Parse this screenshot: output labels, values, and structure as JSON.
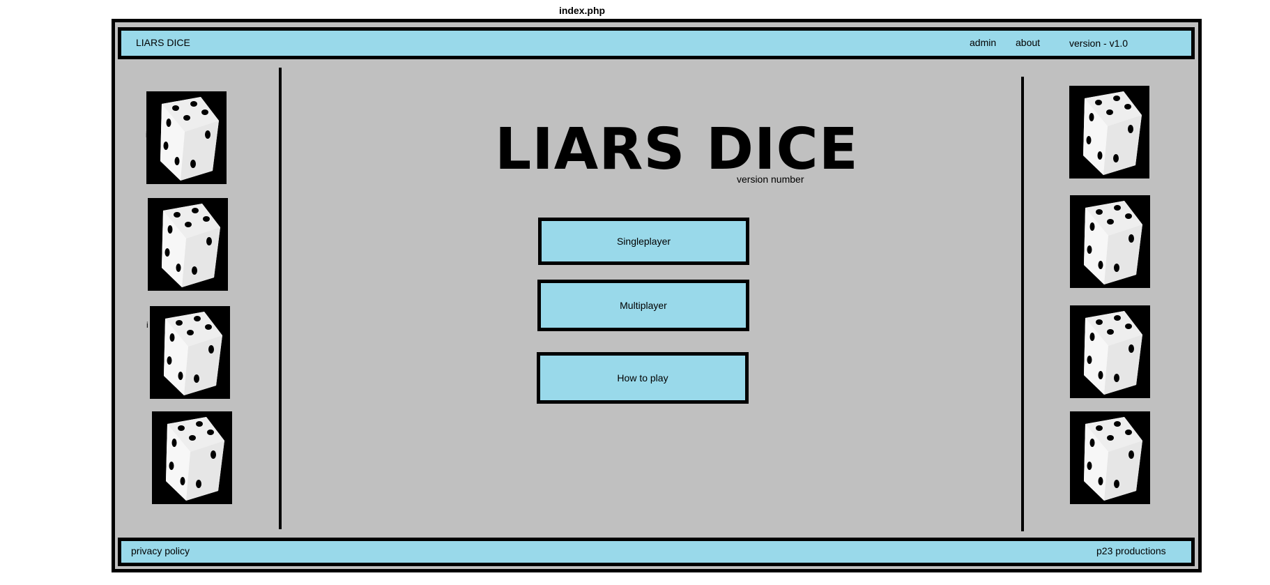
{
  "page": {
    "filename": "index.php"
  },
  "header": {
    "title": "LIARS DICE",
    "nav": [
      {
        "label": "admin"
      },
      {
        "label": "about"
      }
    ],
    "version": "version - v1.0"
  },
  "main": {
    "title": "LIARS DICE",
    "version_label": "version number",
    "buttons": [
      {
        "label": "Singleplayer"
      },
      {
        "label": "Multiplayer"
      },
      {
        "label": "How to play"
      }
    ]
  },
  "footer": {
    "privacy": "privacy policy",
    "credit": "p23 productions"
  },
  "decor": {
    "die_icon": "dice-four-pips-icon",
    "stray_glyph": "i"
  },
  "colors": {
    "bar_background": "#99d9ea",
    "page_background": "#c0c0c0",
    "border": "#000000"
  }
}
